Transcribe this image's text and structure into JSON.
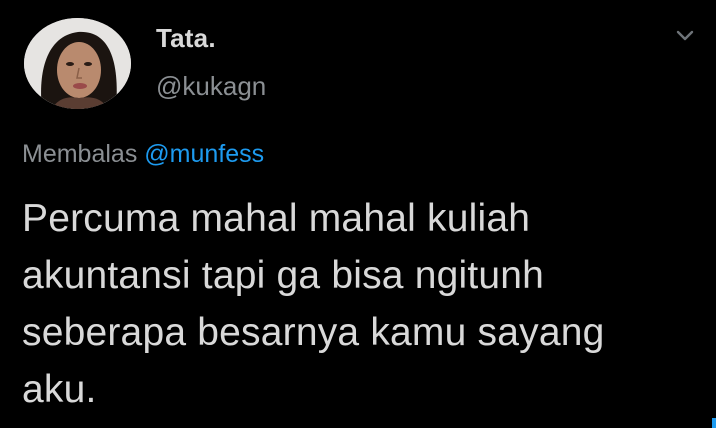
{
  "author": {
    "display_name": "Tata.",
    "handle": "@kukagn",
    "avatar": "profile-photo"
  },
  "reply": {
    "prefix": "Membalas",
    "mention": "@munfess"
  },
  "tweet": {
    "lines": [
      "Percuma mahal mahal kuliah",
      "akuntansi tapi ga bisa ngitunh",
      "seberapa besarnya kamu sayang",
      "aku."
    ]
  },
  "icons": {
    "menu": "chevron-down-icon"
  },
  "colors": {
    "background": "#000000",
    "text": "#d9d9d9",
    "muted": "#8b8f93",
    "link": "#1d9bf0"
  }
}
